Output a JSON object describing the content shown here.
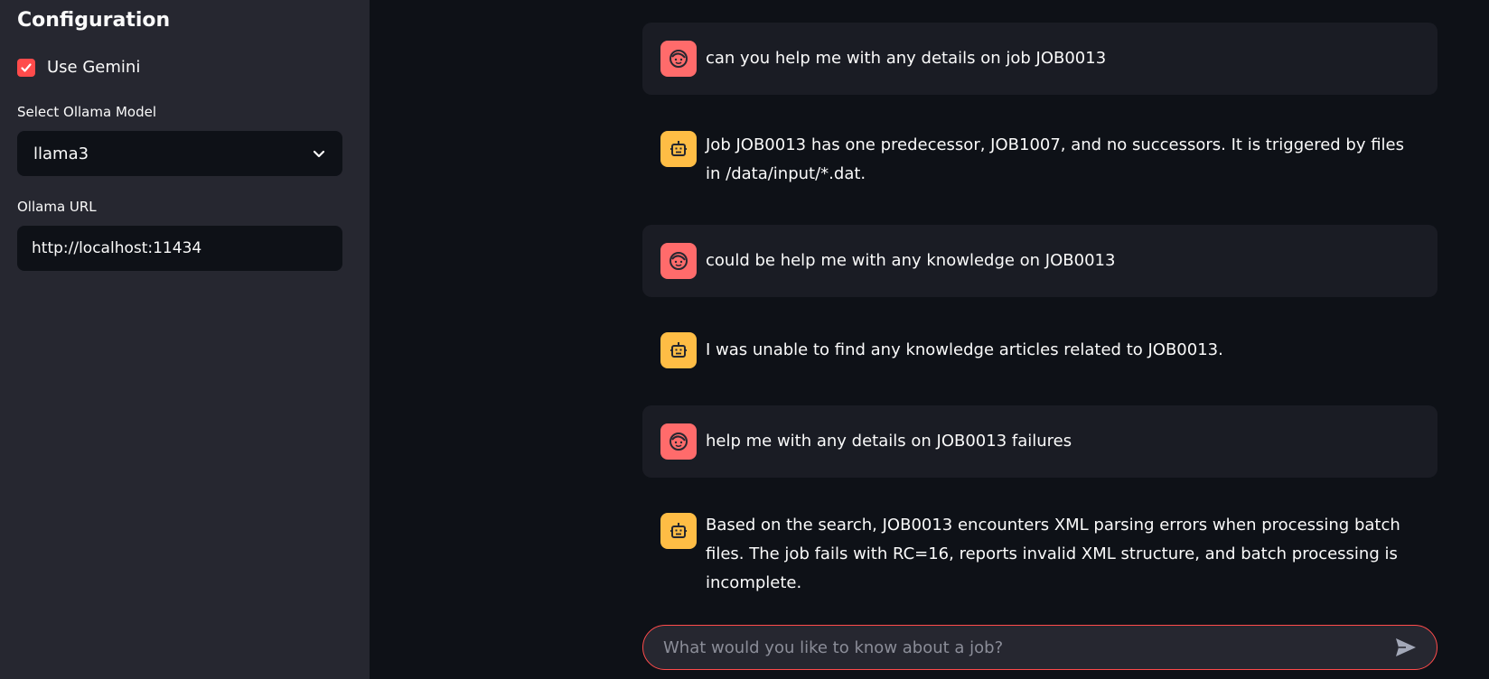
{
  "sidebar": {
    "title": "Configuration",
    "use_gemini": {
      "label": "Use Gemini",
      "checked": true
    },
    "model_select": {
      "label": "Select Ollama Model",
      "value": "llama3"
    },
    "ollama_url": {
      "label": "Ollama URL",
      "value": "http://localhost:11434"
    }
  },
  "chat": {
    "messages": [
      {
        "role": "user",
        "text": "can you help me with any details on job JOB0013"
      },
      {
        "role": "assistant",
        "text": "Job JOB0013 has one predecessor, JOB1007, and no successors. It is triggered by files in /data/input/*.dat."
      },
      {
        "role": "user",
        "text": "could be help me with any knowledge on JOB0013"
      },
      {
        "role": "assistant",
        "text": "I was unable to find any knowledge articles related to JOB0013."
      },
      {
        "role": "user",
        "text": "help me with any details on JOB0013 failures"
      },
      {
        "role": "assistant",
        "text": "Based on the search, JOB0013 encounters XML parsing errors when processing batch files. The job fails with RC=16, reports invalid XML structure, and batch processing is incomplete."
      }
    ],
    "input_placeholder": "What would you like to know about a job?"
  },
  "colors": {
    "accent": "#ff4b4b",
    "user_avatar": "#ff6b6b",
    "bot_avatar": "#ffbd45",
    "sidebar_bg": "#262730",
    "main_bg": "#0e1117"
  },
  "icons": {
    "checkbox": "check-icon",
    "select": "chevron-down-icon",
    "user_avatar": "face-icon",
    "bot_avatar": "robot-icon",
    "send": "send-icon"
  }
}
